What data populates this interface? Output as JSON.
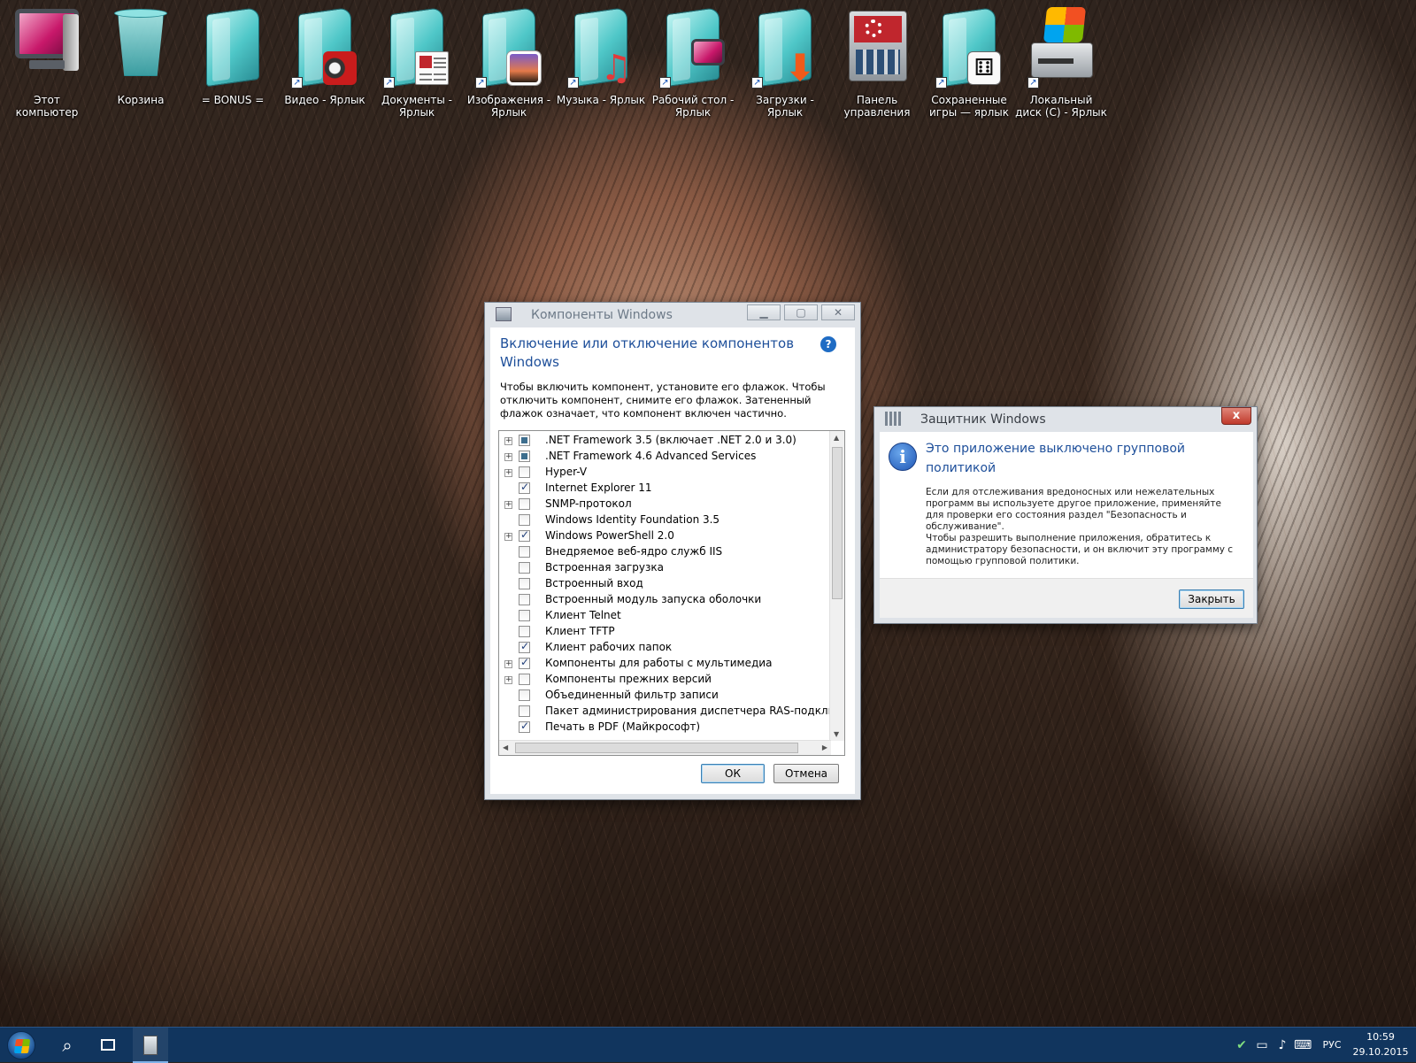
{
  "desktop": {
    "icons": [
      {
        "label": "Этот компьютер",
        "icon": "monitor-icon"
      },
      {
        "label": "Корзина",
        "icon": "recycle-bin-icon"
      },
      {
        "label": "= BONUS =",
        "icon": "folder-icon"
      },
      {
        "label": "Видео - Ярлык",
        "icon": "video-camera-icon"
      },
      {
        "label": "Документы - Ярлык",
        "icon": "document-icon"
      },
      {
        "label": "Изображения - Ярлык",
        "icon": "picture-icon"
      },
      {
        "label": "Музыка - Ярлык",
        "icon": "music-note-icon"
      },
      {
        "label": "Рабочий стол - Ярлык",
        "icon": "desktop-icon"
      },
      {
        "label": "Загрузки - Ярлык",
        "icon": "download-arrow-icon"
      },
      {
        "label": "Панель управления",
        "icon": "control-panel-icon"
      },
      {
        "label": "Сохраненные игры — ярлык",
        "icon": "dice-icon"
      },
      {
        "label": "Локальный диск (C) - Ярлык",
        "icon": "hard-drive-icon"
      }
    ]
  },
  "features_window": {
    "title": "Компоненты Windows",
    "heading": "Включение или отключение компонентов Windows",
    "help_glyph": "?",
    "description": "Чтобы включить компонент, установите его флажок. Чтобы отключить компонент, снимите его флажок. Затененный флажок означает, что компонент включен частично.",
    "items": [
      {
        "name": ".NET Framework 3.5 (включает .NET 2.0 и 3.0)",
        "state": "partial",
        "expandable": true
      },
      {
        "name": ".NET Framework 4.6 Advanced Services",
        "state": "partial",
        "expandable": true
      },
      {
        "name": "Hyper-V",
        "state": "unchecked",
        "expandable": true
      },
      {
        "name": "Internet Explorer 11",
        "state": "checked",
        "expandable": false
      },
      {
        "name": "SNMP-протокол",
        "state": "unchecked",
        "expandable": true
      },
      {
        "name": "Windows Identity Foundation 3.5",
        "state": "unchecked",
        "expandable": false
      },
      {
        "name": "Windows PowerShell 2.0",
        "state": "checked",
        "expandable": true
      },
      {
        "name": "Внедряемое веб-ядро служб IIS",
        "state": "unchecked",
        "expandable": false
      },
      {
        "name": "Встроенная загрузка",
        "state": "unchecked",
        "expandable": false
      },
      {
        "name": "Встроенный вход",
        "state": "unchecked",
        "expandable": false
      },
      {
        "name": "Встроенный модуль запуска оболочки",
        "state": "unchecked",
        "expandable": false
      },
      {
        "name": "Клиент Telnet",
        "state": "unchecked",
        "expandable": false
      },
      {
        "name": "Клиент TFTP",
        "state": "unchecked",
        "expandable": false
      },
      {
        "name": "Клиент рабочих папок",
        "state": "checked",
        "expandable": false
      },
      {
        "name": "Компоненты для работы с мультимедиа",
        "state": "checked",
        "expandable": true
      },
      {
        "name": "Компоненты прежних версий",
        "state": "unchecked",
        "expandable": true
      },
      {
        "name": "Объединенный фильтр записи",
        "state": "unchecked",
        "expandable": false
      },
      {
        "name": "Пакет администрирования диспетчера RAS-подключений",
        "state": "unchecked",
        "expandable": false
      },
      {
        "name": "Печать в PDF (Майкрософт)",
        "state": "checked",
        "expandable": false
      }
    ],
    "ok_label": "ОК",
    "cancel_label": "Отмена"
  },
  "defender_dialog": {
    "title": "Защитник Windows",
    "heading": "Это приложение выключено групповой политикой",
    "paragraph1": "Если для отслеживания вредоносных или нежелательных программ вы используете другое приложение, применяйте для проверки его состояния раздел \"Безопасность и обслуживание\".",
    "paragraph2": "Чтобы разрешить выполнение приложения, обратитесь к администратору безопасности, и он включит эту программу с помощью групповой политики.",
    "close_label": "Закрыть",
    "close_glyph": "x",
    "info_glyph": "i"
  },
  "taskbar": {
    "language": "РУС",
    "time": "10:59",
    "date": "29.10.2015"
  },
  "colors": {
    "accent_blue": "#1e4f9a",
    "taskbar": "#11355e",
    "close_red": "#c0392b"
  }
}
